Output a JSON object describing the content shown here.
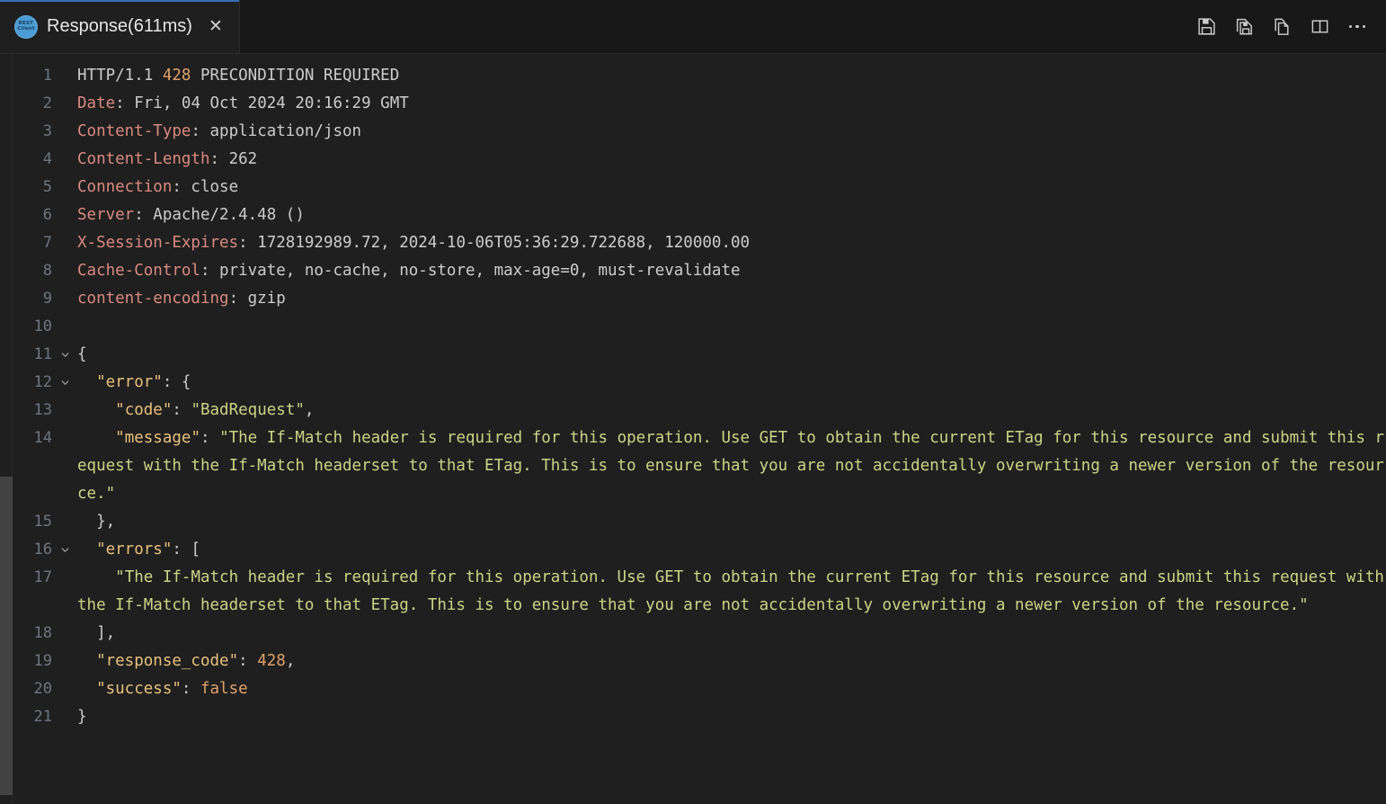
{
  "window": {
    "tab": {
      "label": "Response(611ms)",
      "icon_name": "rest-client-icon",
      "icon_text_top": "REST",
      "icon_text_bottom": "Client",
      "close_label": "✕",
      "active": true,
      "accent_color": "#3a6fb8"
    },
    "toolbar": {
      "save_label": "Save",
      "save_all_label": "Save All",
      "copy_label": "Copy",
      "split_editor_label": "Split Editor Right",
      "more_label": "More Actions...",
      "icons": [
        "save-icon",
        "save-all-icon",
        "copy-icon",
        "split-editor-icon",
        "more-actions-icon"
      ]
    }
  },
  "theme": {
    "editor_background": "#1f1f1f",
    "tabbar_background": "#181818",
    "line_number_color": "#6e7681",
    "header_name_color": "#d98a80",
    "json_key_color": "#e8c07d",
    "string_color": "#cbd585",
    "number_color": "#dfa36a",
    "default_text_color": "#cccccc"
  },
  "editor": {
    "language": "HTTP Response",
    "lines": [
      {
        "n": "1",
        "fold": "",
        "tokens": [
          {
            "t": "HTTP/1.1 ",
            "c": "t-plain"
          },
          {
            "t": "428",
            "c": "t-num"
          },
          {
            "t": " PRECONDITION REQUIRED",
            "c": "t-plain"
          }
        ]
      },
      {
        "n": "2",
        "fold": "",
        "tokens": [
          {
            "t": "Date",
            "c": "t-header"
          },
          {
            "t": ": Fri, 04 Oct 2024 20:16:29 GMT",
            "c": "t-plain"
          }
        ]
      },
      {
        "n": "3",
        "fold": "",
        "tokens": [
          {
            "t": "Content-Type",
            "c": "t-header"
          },
          {
            "t": ": application/json",
            "c": "t-plain"
          }
        ]
      },
      {
        "n": "4",
        "fold": "",
        "tokens": [
          {
            "t": "Content-Length",
            "c": "t-header"
          },
          {
            "t": ": 262",
            "c": "t-plain"
          }
        ]
      },
      {
        "n": "5",
        "fold": "",
        "tokens": [
          {
            "t": "Connection",
            "c": "t-header"
          },
          {
            "t": ": close",
            "c": "t-plain"
          }
        ]
      },
      {
        "n": "6",
        "fold": "",
        "tokens": [
          {
            "t": "Server",
            "c": "t-header"
          },
          {
            "t": ": Apache/2.4.48 ()",
            "c": "t-plain"
          }
        ]
      },
      {
        "n": "7",
        "fold": "",
        "tokens": [
          {
            "t": "X-Session-Expires",
            "c": "t-header"
          },
          {
            "t": ": 1728192989.72, 2024-10-06T05:36:29.722688, 120000.00",
            "c": "t-plain"
          }
        ]
      },
      {
        "n": "8",
        "fold": "",
        "tokens": [
          {
            "t": "Cache-Control",
            "c": "t-header"
          },
          {
            "t": ": private, no-cache, no-store, max-age=0, must-revalidate",
            "c": "t-plain"
          }
        ]
      },
      {
        "n": "9",
        "fold": "",
        "tokens": [
          {
            "t": "content-encoding",
            "c": "t-header"
          },
          {
            "t": ": gzip",
            "c": "t-plain"
          }
        ]
      },
      {
        "n": "10",
        "fold": "",
        "tokens": []
      },
      {
        "n": "11",
        "fold": "chevron-down",
        "tokens": [
          {
            "t": "{",
            "c": "t-brace"
          }
        ]
      },
      {
        "n": "12",
        "fold": "chevron-down",
        "tokens": [
          {
            "t": "  ",
            "c": "t-plain"
          },
          {
            "t": "\"error\"",
            "c": "t-key"
          },
          {
            "t": ": {",
            "c": "t-brace"
          }
        ]
      },
      {
        "n": "13",
        "fold": "",
        "tokens": [
          {
            "t": "    ",
            "c": "t-plain"
          },
          {
            "t": "\"code\"",
            "c": "t-key"
          },
          {
            "t": ": ",
            "c": "t-punct"
          },
          {
            "t": "\"BadRequest\"",
            "c": "t-string"
          },
          {
            "t": ",",
            "c": "t-punct"
          }
        ]
      },
      {
        "n": "14",
        "fold": "",
        "tokens": [
          {
            "t": "    ",
            "c": "t-plain"
          },
          {
            "t": "\"message\"",
            "c": "t-key"
          },
          {
            "t": ": ",
            "c": "t-punct"
          },
          {
            "t": "\"The If-Match header is required for this operation. Use GET to obtain the current ETag for this resource and submit this request with the If-Match headerset to that ETag. This is to ensure that you are not accidentally overwriting a newer version of the resource.\"",
            "c": "t-string"
          }
        ]
      },
      {
        "n": "15",
        "fold": "",
        "tokens": [
          {
            "t": "  },",
            "c": "t-brace"
          }
        ]
      },
      {
        "n": "16",
        "fold": "chevron-down",
        "tokens": [
          {
            "t": "  ",
            "c": "t-plain"
          },
          {
            "t": "\"errors\"",
            "c": "t-key"
          },
          {
            "t": ": [",
            "c": "t-brace"
          }
        ]
      },
      {
        "n": "17",
        "fold": "",
        "tokens": [
          {
            "t": "    ",
            "c": "t-plain"
          },
          {
            "t": "\"The If-Match header is required for this operation. Use GET to obtain the current ETag for this resource and submit this request with the If-Match headerset to that ETag. This is to ensure that you are not accidentally overwriting a newer version of the resource.\"",
            "c": "t-string"
          }
        ]
      },
      {
        "n": "18",
        "fold": "",
        "tokens": [
          {
            "t": "  ],",
            "c": "t-brace"
          }
        ]
      },
      {
        "n": "19",
        "fold": "",
        "tokens": [
          {
            "t": "  ",
            "c": "t-plain"
          },
          {
            "t": "\"response_code\"",
            "c": "t-key"
          },
          {
            "t": ": ",
            "c": "t-punct"
          },
          {
            "t": "428",
            "c": "t-num"
          },
          {
            "t": ",",
            "c": "t-punct"
          }
        ]
      },
      {
        "n": "20",
        "fold": "",
        "tokens": [
          {
            "t": "  ",
            "c": "t-plain"
          },
          {
            "t": "\"success\"",
            "c": "t-key"
          },
          {
            "t": ": ",
            "c": "t-punct"
          },
          {
            "t": "false",
            "c": "t-bool"
          }
        ]
      },
      {
        "n": "21",
        "fold": "",
        "tokens": [
          {
            "t": "}",
            "c": "t-brace"
          }
        ]
      }
    ]
  }
}
